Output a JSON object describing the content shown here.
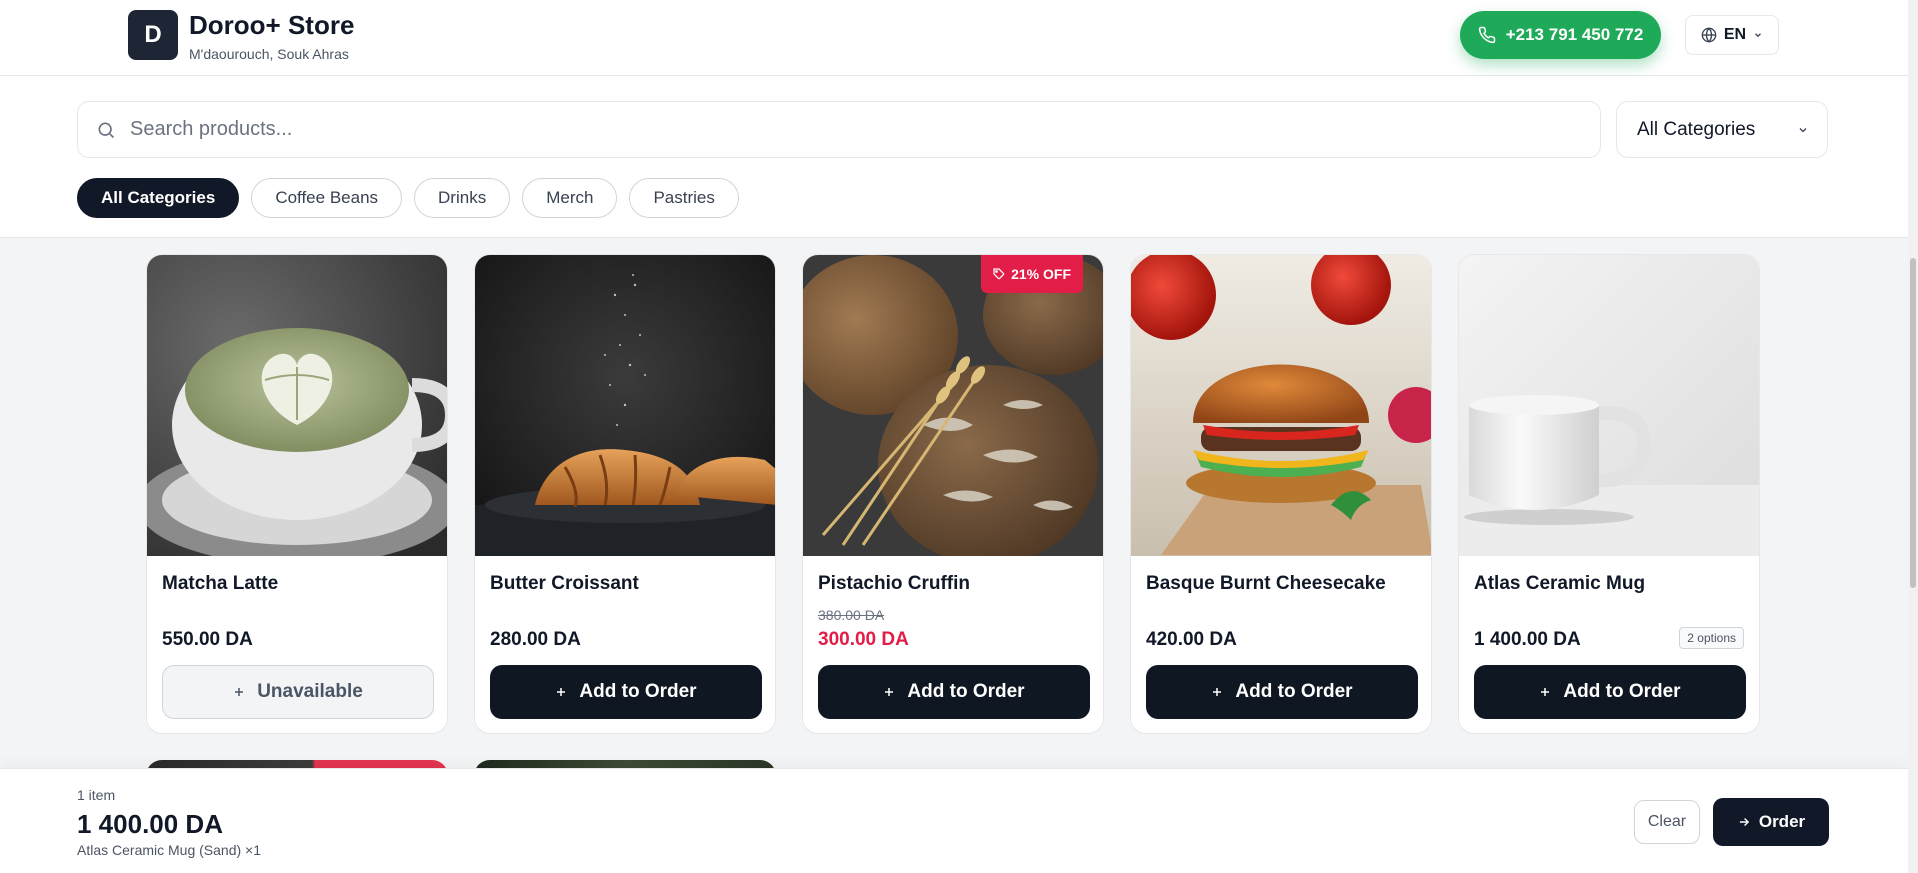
{
  "header": {
    "logo_letter": "D",
    "store_name": "Doroo+ Store",
    "location": "M'daourouch, Souk Ahras",
    "phone": "+213 791 450 772",
    "language": "EN"
  },
  "filters": {
    "search_placeholder": "Search products...",
    "category_select": "All Categories",
    "chips": [
      "All Categories",
      "Coffee Beans",
      "Drinks",
      "Merch",
      "Pastries"
    ],
    "active_chip": "All Categories"
  },
  "products": [
    {
      "name": "Matcha Latte",
      "price": "550.00 DA",
      "button": "Unavailable",
      "available": false,
      "image": "matcha-latte-photo"
    },
    {
      "name": "Butter Croissant",
      "price": "280.00 DA",
      "button": "Add to Order",
      "available": true,
      "image": "croissant-photo"
    },
    {
      "name": "Pistachio Cruffin",
      "old_price": "380.00 DA",
      "price": "300.00 DA",
      "discount": "21% OFF",
      "button": "Add to Order",
      "available": true,
      "image": "bread-photo"
    },
    {
      "name": "Basque Burnt Cheesecake",
      "price": "420.00 DA",
      "button": "Add to Order",
      "available": true,
      "image": "burger-photo"
    },
    {
      "name": "Atlas Ceramic Mug",
      "price": "1 400.00 DA",
      "options": "2 options",
      "button": "Add to Order",
      "available": true,
      "image": "mug-photo"
    }
  ],
  "cart": {
    "count": "1 item",
    "total": "1 400.00 DA",
    "items": "Atlas Ceramic Mug (Sand) ×1",
    "clear": "Clear",
    "order": "Order"
  },
  "colors": {
    "primary": "#111827",
    "phone_green": "#1faa59",
    "sale_red": "#e11d48"
  },
  "icons": [
    "phone-icon",
    "globe-icon",
    "chevron-down-icon",
    "search-icon",
    "plus-icon",
    "tag-icon",
    "arrow-right-icon"
  ]
}
